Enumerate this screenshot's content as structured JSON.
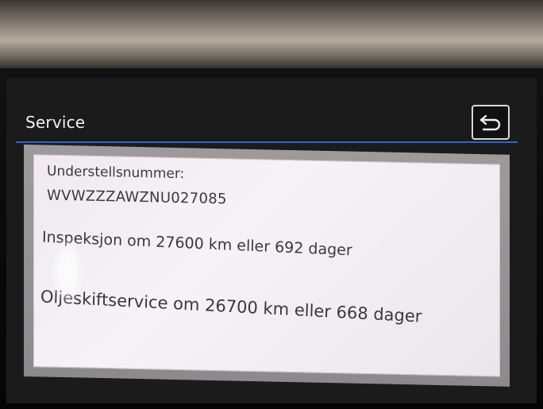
{
  "header": {
    "title": "Service",
    "back_icon": "back-arrow-icon"
  },
  "service_info": {
    "vin_label": "Understellsnummer:",
    "vin_value": "WVWZZZAWZNU027085",
    "inspection": "Inspeksjon om 27600 km eller 692 dager",
    "oil_change": "Oljeskiftservice om 26700 km eller 668 dager"
  },
  "colors": {
    "accent_line": "#2a67c9",
    "panel_bg": "#f2eef1",
    "header_bg": "#1b1b1b"
  }
}
